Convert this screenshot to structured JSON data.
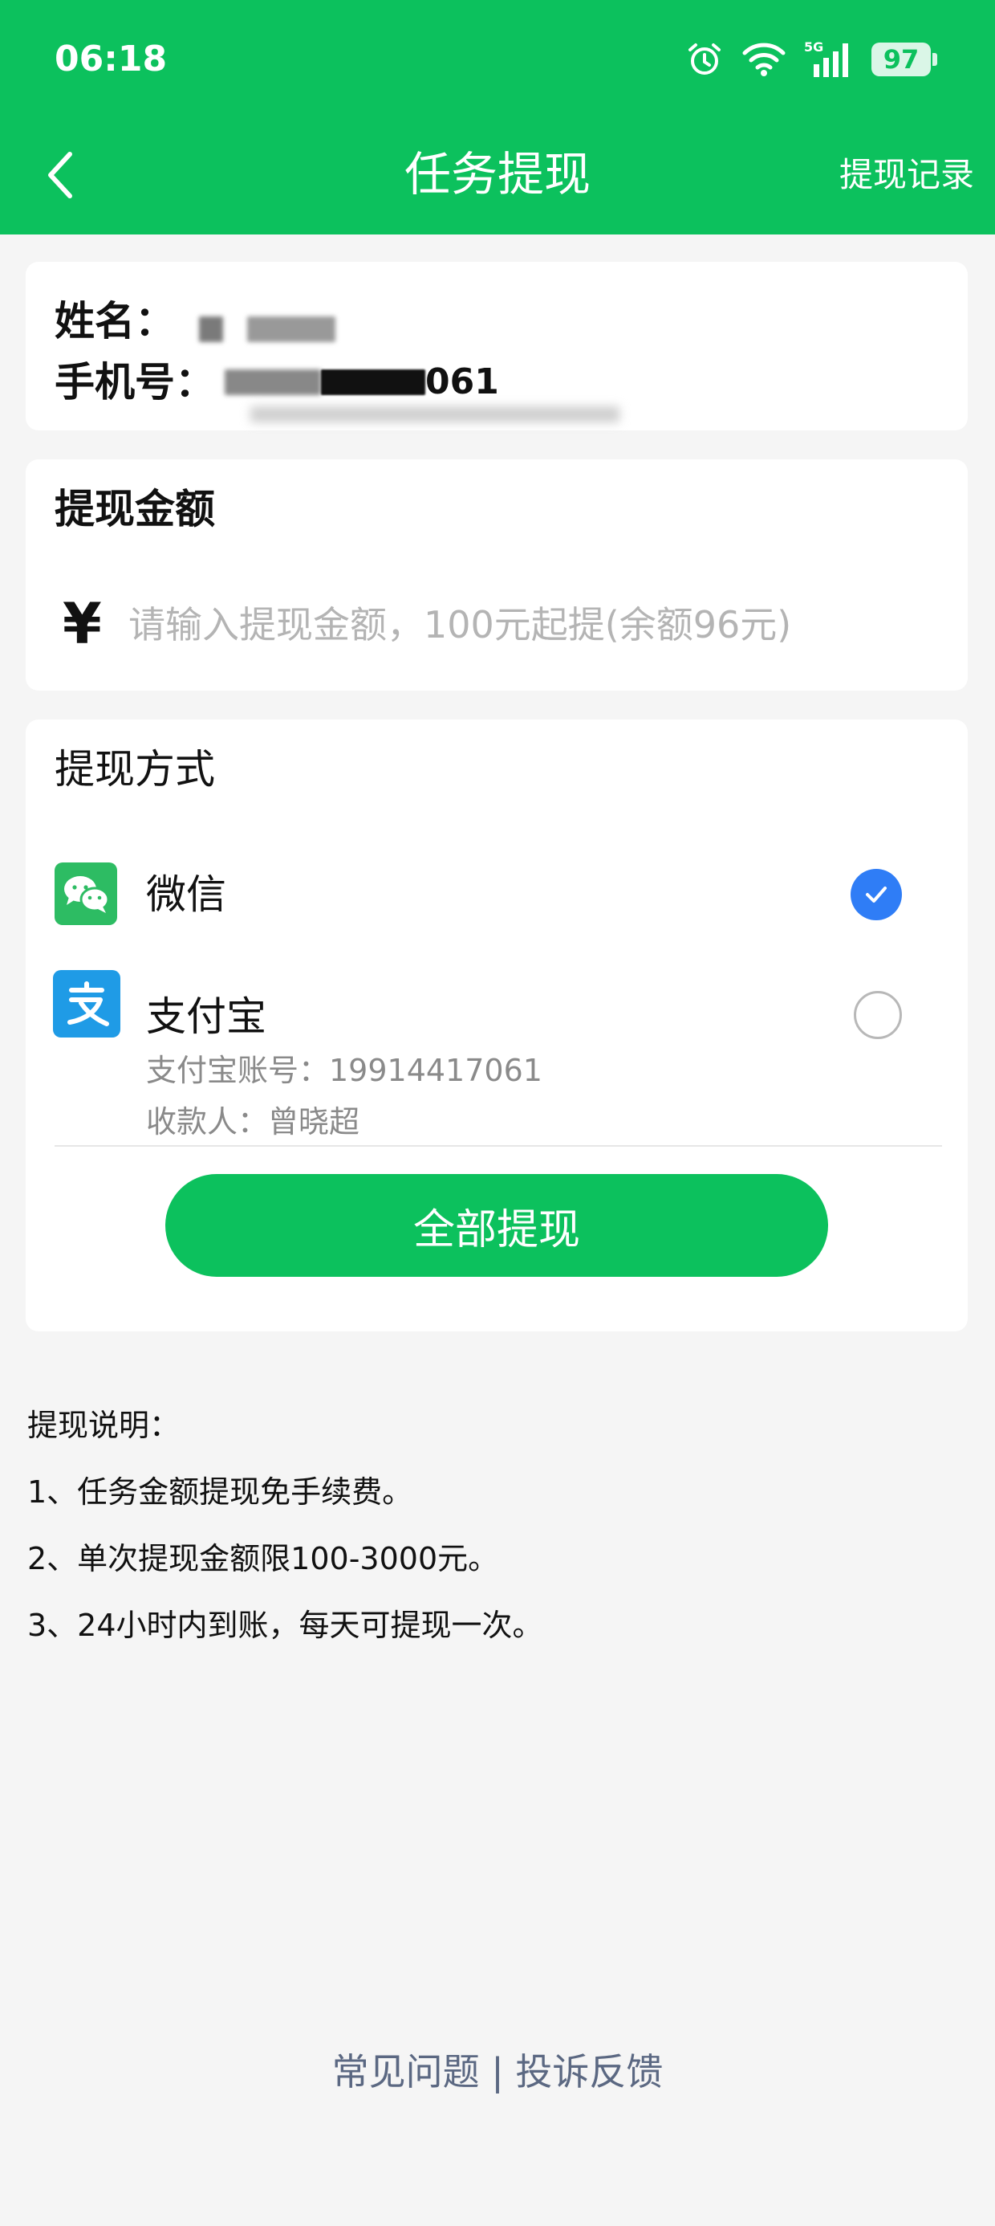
{
  "status_bar": {
    "time": "06:18",
    "network": "5G",
    "battery": "97",
    "icons": [
      "alarm-icon",
      "wifi-icon",
      "signal-icon",
      "battery-icon"
    ]
  },
  "nav": {
    "back_icon": "chevron-left-icon",
    "title": "任务提现",
    "right_link": "提现记录"
  },
  "user_info": {
    "name_label": "姓名：",
    "phone_label": "手机号：",
    "phone_visible_suffix": "061"
  },
  "amount": {
    "title": "提现金额",
    "currency_symbol": "¥",
    "placeholder": "请输入提现金额，100元起提(余额96元)",
    "value": ""
  },
  "method": {
    "title": "提现方式",
    "options": [
      {
        "label": "微信",
        "icon": "wechat-icon",
        "selected": true
      },
      {
        "label": "支付宝",
        "icon": "alipay-icon",
        "selected": false,
        "account": "支付宝账号：19914417061",
        "payee": "收款人：曾晓超"
      }
    ],
    "withdraw_all_button": "全部提现"
  },
  "notes": {
    "title": "提现说明：",
    "items": [
      "1、任务金额提现免手续费。",
      "2、单次提现金额限100-3000元。",
      "3、24小时内到账，每天可提现一次。"
    ]
  },
  "footer": {
    "faq": "常见问题",
    "separator": "|",
    "complaint": "投诉反馈"
  },
  "colors": {
    "brand_green": "#0cc15d",
    "check_blue": "#2f7df6",
    "wechat_green": "#2dbc63",
    "alipay_blue": "#1f9be6",
    "footer_link": "#5b6882"
  }
}
